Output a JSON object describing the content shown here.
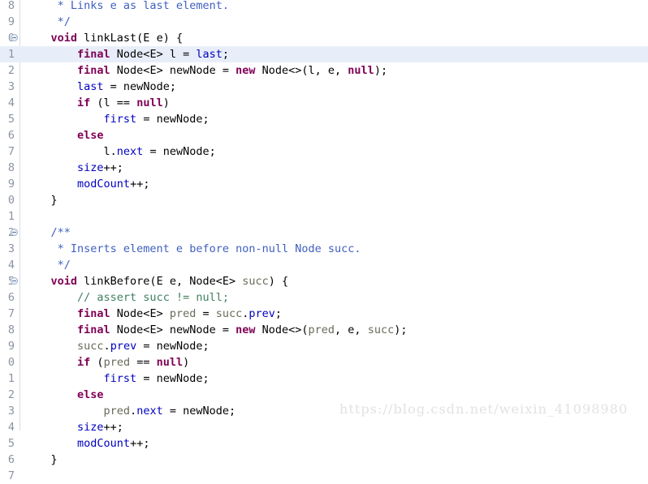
{
  "app": {
    "name": "eclipse-java-editor",
    "title": "LinkedList.java"
  },
  "editor": {
    "background_color": "#ffffff",
    "gutter_separator_color": "#d9dde4",
    "current_line_highlight_color": "#e8eef9",
    "line_number_color": "#8a93a3",
    "font_size_px": 13.5,
    "line_height_px": 20,
    "first_visible_line_clipped": true
  },
  "colors": {
    "keyword": "#7f0055",
    "field": "#0000c0",
    "local_variable": "#6a6a5a",
    "javadoc_comment": "#3f5fbf",
    "line_comment": "#3f7f5f",
    "plain_text": "#000000",
    "watermark": "#e2e2e2"
  },
  "watermark": {
    "text": "https://blog.csdn.net/weixin_41098980"
  },
  "lines": [
    {
      "number": "8",
      "fold": false,
      "highlighted": false,
      "clipped": true,
      "tokens": [
        {
          "t": "     * Links e as last element.",
          "c": "cmt"
        }
      ]
    },
    {
      "number": "9",
      "fold": false,
      "highlighted": false,
      "tokens": [
        {
          "t": "     */",
          "c": "cmt"
        }
      ]
    },
    {
      "number": "0",
      "fold": true,
      "highlighted": false,
      "tokens": [
        {
          "t": "    ",
          "c": "plain"
        },
        {
          "t": "void",
          "c": "kw"
        },
        {
          "t": " linkLast(E e) {",
          "c": "plain"
        }
      ]
    },
    {
      "number": "1",
      "fold": false,
      "highlighted": true,
      "tokens": [
        {
          "t": "        ",
          "c": "plain"
        },
        {
          "t": "final",
          "c": "kw"
        },
        {
          "t": " Node<E> ",
          "c": "plain"
        },
        {
          "t": "l",
          "c": "plain"
        },
        {
          "t": " = ",
          "c": "plain"
        },
        {
          "t": "last",
          "c": "fld"
        },
        {
          "t": ";",
          "c": "plain"
        }
      ]
    },
    {
      "number": "2",
      "fold": false,
      "highlighted": false,
      "tokens": [
        {
          "t": "        ",
          "c": "plain"
        },
        {
          "t": "final",
          "c": "kw"
        },
        {
          "t": " Node<E> newNode = ",
          "c": "plain"
        },
        {
          "t": "new",
          "c": "kw"
        },
        {
          "t": " Node<>(l, e, ",
          "c": "plain"
        },
        {
          "t": "null",
          "c": "kw"
        },
        {
          "t": ");",
          "c": "plain"
        }
      ]
    },
    {
      "number": "3",
      "fold": false,
      "highlighted": false,
      "tokens": [
        {
          "t": "        ",
          "c": "plain"
        },
        {
          "t": "last",
          "c": "fld"
        },
        {
          "t": " = newNode;",
          "c": "plain"
        }
      ]
    },
    {
      "number": "4",
      "fold": false,
      "highlighted": false,
      "tokens": [
        {
          "t": "        ",
          "c": "plain"
        },
        {
          "t": "if",
          "c": "kw"
        },
        {
          "t": " (l == ",
          "c": "plain"
        },
        {
          "t": "null",
          "c": "kw"
        },
        {
          "t": ")",
          "c": "plain"
        }
      ]
    },
    {
      "number": "5",
      "fold": false,
      "highlighted": false,
      "tokens": [
        {
          "t": "            ",
          "c": "plain"
        },
        {
          "t": "first",
          "c": "fld"
        },
        {
          "t": " = newNode;",
          "c": "plain"
        }
      ]
    },
    {
      "number": "6",
      "fold": false,
      "highlighted": false,
      "tokens": [
        {
          "t": "        ",
          "c": "plain"
        },
        {
          "t": "else",
          "c": "kw"
        }
      ]
    },
    {
      "number": "7",
      "fold": false,
      "highlighted": false,
      "tokens": [
        {
          "t": "            l.",
          "c": "plain"
        },
        {
          "t": "next",
          "c": "fld"
        },
        {
          "t": " = newNode;",
          "c": "plain"
        }
      ]
    },
    {
      "number": "8",
      "fold": false,
      "highlighted": false,
      "tokens": [
        {
          "t": "        ",
          "c": "plain"
        },
        {
          "t": "size",
          "c": "fld"
        },
        {
          "t": "++;",
          "c": "plain"
        }
      ]
    },
    {
      "number": "9",
      "fold": false,
      "highlighted": false,
      "tokens": [
        {
          "t": "        ",
          "c": "plain"
        },
        {
          "t": "modCount",
          "c": "fld"
        },
        {
          "t": "++;",
          "c": "plain"
        }
      ]
    },
    {
      "number": "0",
      "fold": false,
      "highlighted": false,
      "tokens": [
        {
          "t": "    }",
          "c": "plain"
        }
      ]
    },
    {
      "number": "1",
      "fold": false,
      "highlighted": false,
      "tokens": [
        {
          "t": "",
          "c": "plain"
        }
      ]
    },
    {
      "number": "2",
      "fold": true,
      "highlighted": false,
      "tokens": [
        {
          "t": "    /**",
          "c": "cmt"
        }
      ]
    },
    {
      "number": "3",
      "fold": false,
      "highlighted": false,
      "tokens": [
        {
          "t": "     * Inserts element e before non-null Node succ.",
          "c": "cmt"
        }
      ]
    },
    {
      "number": "4",
      "fold": false,
      "highlighted": false,
      "tokens": [
        {
          "t": "     */",
          "c": "cmt"
        }
      ]
    },
    {
      "number": "5",
      "fold": true,
      "highlighted": false,
      "tokens": [
        {
          "t": "    ",
          "c": "plain"
        },
        {
          "t": "void",
          "c": "kw"
        },
        {
          "t": " linkBefore(E e, Node<E> ",
          "c": "plain"
        },
        {
          "t": "succ",
          "c": "loc"
        },
        {
          "t": ") {",
          "c": "plain"
        }
      ]
    },
    {
      "number": "6",
      "fold": false,
      "highlighted": false,
      "tokens": [
        {
          "t": "        ",
          "c": "plain"
        },
        {
          "t": "// assert succ != null;",
          "c": "lcmt"
        }
      ]
    },
    {
      "number": "7",
      "fold": false,
      "highlighted": false,
      "tokens": [
        {
          "t": "        ",
          "c": "plain"
        },
        {
          "t": "final",
          "c": "kw"
        },
        {
          "t": " Node<E> ",
          "c": "plain"
        },
        {
          "t": "pred",
          "c": "loc"
        },
        {
          "t": " = ",
          "c": "plain"
        },
        {
          "t": "succ",
          "c": "loc"
        },
        {
          "t": ".",
          "c": "plain"
        },
        {
          "t": "prev",
          "c": "fld"
        },
        {
          "t": ";",
          "c": "plain"
        }
      ]
    },
    {
      "number": "8",
      "fold": false,
      "highlighted": false,
      "tokens": [
        {
          "t": "        ",
          "c": "plain"
        },
        {
          "t": "final",
          "c": "kw"
        },
        {
          "t": " Node<E> newNode = ",
          "c": "plain"
        },
        {
          "t": "new",
          "c": "kw"
        },
        {
          "t": " Node<>(",
          "c": "plain"
        },
        {
          "t": "pred",
          "c": "loc"
        },
        {
          "t": ", e, ",
          "c": "plain"
        },
        {
          "t": "succ",
          "c": "loc"
        },
        {
          "t": ");",
          "c": "plain"
        }
      ]
    },
    {
      "number": "9",
      "fold": false,
      "highlighted": false,
      "tokens": [
        {
          "t": "        ",
          "c": "plain"
        },
        {
          "t": "succ",
          "c": "loc"
        },
        {
          "t": ".",
          "c": "plain"
        },
        {
          "t": "prev",
          "c": "fld"
        },
        {
          "t": " = newNode;",
          "c": "plain"
        }
      ]
    },
    {
      "number": "0",
      "fold": false,
      "highlighted": false,
      "tokens": [
        {
          "t": "        ",
          "c": "plain"
        },
        {
          "t": "if",
          "c": "kw"
        },
        {
          "t": " (",
          "c": "plain"
        },
        {
          "t": "pred",
          "c": "loc"
        },
        {
          "t": " == ",
          "c": "plain"
        },
        {
          "t": "null",
          "c": "kw"
        },
        {
          "t": ")",
          "c": "plain"
        }
      ]
    },
    {
      "number": "1",
      "fold": false,
      "highlighted": false,
      "tokens": [
        {
          "t": "            ",
          "c": "plain"
        },
        {
          "t": "first",
          "c": "fld"
        },
        {
          "t": " = newNode;",
          "c": "plain"
        }
      ]
    },
    {
      "number": "2",
      "fold": false,
      "highlighted": false,
      "tokens": [
        {
          "t": "        ",
          "c": "plain"
        },
        {
          "t": "else",
          "c": "kw"
        }
      ]
    },
    {
      "number": "3",
      "fold": false,
      "highlighted": false,
      "tokens": [
        {
          "t": "            ",
          "c": "plain"
        },
        {
          "t": "pred",
          "c": "loc"
        },
        {
          "t": ".",
          "c": "plain"
        },
        {
          "t": "next",
          "c": "fld"
        },
        {
          "t": " = newNode;",
          "c": "plain"
        }
      ]
    },
    {
      "number": "4",
      "fold": false,
      "highlighted": false,
      "tokens": [
        {
          "t": "        ",
          "c": "plain"
        },
        {
          "t": "size",
          "c": "fld"
        },
        {
          "t": "++;",
          "c": "plain"
        }
      ]
    },
    {
      "number": "5",
      "fold": false,
      "highlighted": false,
      "tokens": [
        {
          "t": "        ",
          "c": "plain"
        },
        {
          "t": "modCount",
          "c": "fld"
        },
        {
          "t": "++;",
          "c": "plain"
        }
      ]
    },
    {
      "number": "6",
      "fold": false,
      "highlighted": false,
      "tokens": [
        {
          "t": "    }",
          "c": "plain"
        }
      ]
    },
    {
      "number": "7",
      "fold": false,
      "highlighted": false,
      "tokens": [
        {
          "t": "",
          "c": "plain"
        }
      ]
    }
  ]
}
